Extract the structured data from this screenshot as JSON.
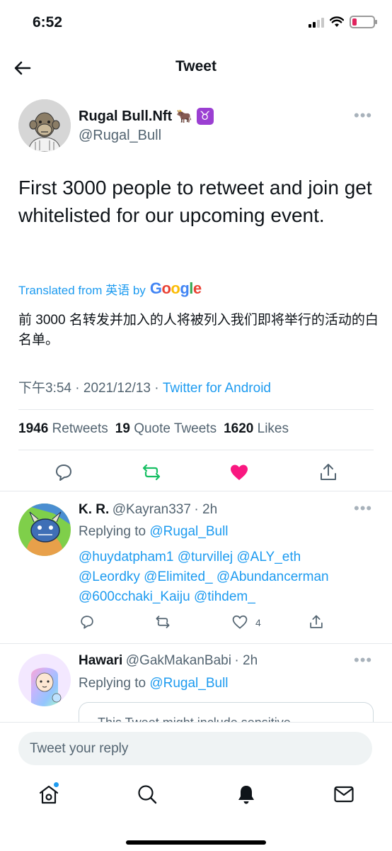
{
  "status_bar": {
    "time": "6:52"
  },
  "header": {
    "title": "Tweet"
  },
  "tweet": {
    "author_name": "Rugal Bull.Nft",
    "author_emoji": "🐂",
    "author_badge": "♉",
    "author_handle": "@Rugal_Bull",
    "text": "First 3000 people to retweet and join get whitelisted for our upcoming event.",
    "translated_label": "Translated from 英语 by",
    "translator": "Google",
    "translation": "前 3000 名转发并加入的人将被列入我们即将举行的活动的白名单。",
    "time": "下午3:54",
    "date": "2021/12/13",
    "separator": "·",
    "source": "Twitter for Android",
    "stats": {
      "retweets_count": "1946",
      "retweets_label": "Retweets",
      "quotes_count": "19",
      "quotes_label": "Quote Tweets",
      "likes_count": "1620",
      "likes_label": "Likes"
    },
    "colors": {
      "retweet": "#17bf63",
      "like": "#f91880",
      "link": "#1d9bf0"
    }
  },
  "replies": [
    {
      "name": "K. R.",
      "handle": "@Kayran337",
      "time": "· 2h",
      "replying_prefix": "Replying to",
      "replying_to": "@Rugal_Bull",
      "mentions_line1": "@huydatpham1 @turvillej @ALY_eth",
      "mentions_line2": "@Leordky @Elimited_ @Abundancerman",
      "mentions_line3": "@600cchaki_Kaiju @tihdem_",
      "like_count": "4"
    },
    {
      "name": "Hawari",
      "handle": "@GakMakanBabi",
      "time": "· 2h",
      "replying_prefix": "Replying to",
      "replying_to": "@Rugal_Bull",
      "sensitive_notice": "This Tweet might include sensitive"
    }
  ],
  "compose": {
    "placeholder": "Tweet your reply"
  },
  "tab_bar": [
    "home-icon",
    "search-icon",
    "notifications-icon",
    "messages-icon"
  ]
}
